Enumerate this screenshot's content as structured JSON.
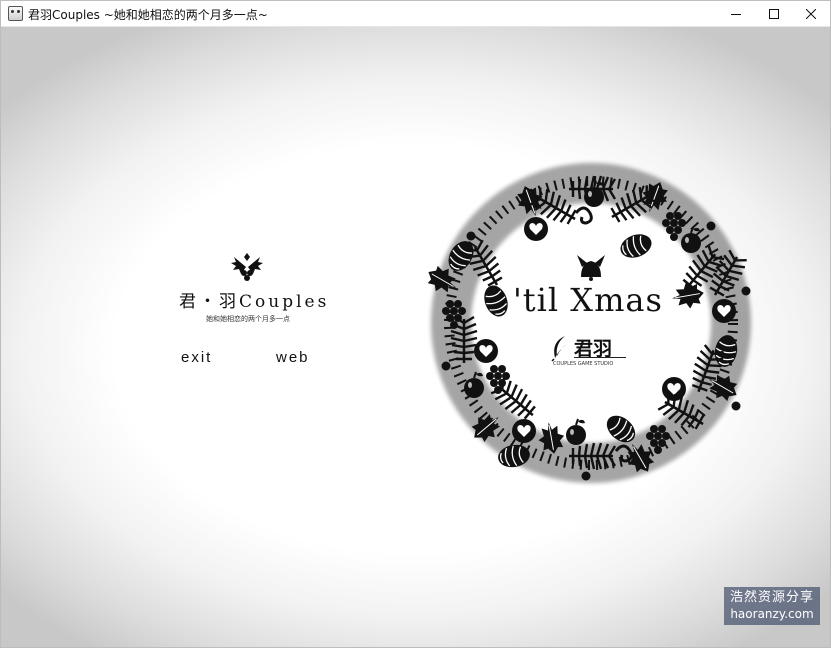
{
  "window": {
    "title": "君羽Couples ~她和她相恋的两个月多一点~",
    "controls": [
      "minimize",
      "maximize",
      "close"
    ]
  },
  "menu": {
    "brand": "君・羽Couples",
    "subtitle": "她和她相恋的两个月多一点",
    "items": [
      {
        "label": "exit"
      },
      {
        "label": "web"
      }
    ]
  },
  "wreath": {
    "heading": "'til Xmas",
    "logo_text": "君羽",
    "logo_subtext": "COUPLES GAME STUDIO"
  },
  "watermark": {
    "line1": "浩然资源分享",
    "line2": "haoranzy.com"
  },
  "colors": {
    "ink": "#111111",
    "vignette": "#c8c8c8",
    "watermark_bg": "#46526e"
  }
}
